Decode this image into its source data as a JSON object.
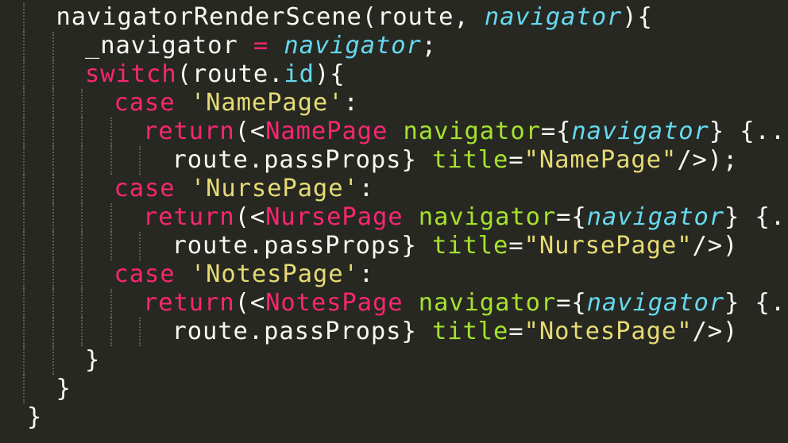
{
  "editor": {
    "theme": "monokai",
    "colors": {
      "background": "#272822",
      "plain": "#f8f8f2",
      "keyword": "#f92672",
      "string": "#e6db74",
      "parameter": "#66d9ef",
      "attribute": "#a6e22e",
      "indent_guide": "#5a5b53"
    },
    "lines": [
      {
        "indent": 1,
        "tokens": [
          {
            "t": "navigatorRenderScene(route, ",
            "c": "plain"
          },
          {
            "t": "navigator",
            "c": "parameter",
            "i": true
          },
          {
            "t": "){",
            "c": "plain"
          }
        ]
      },
      {
        "indent": 2,
        "tokens": [
          {
            "t": "_navigator ",
            "c": "plain"
          },
          {
            "t": "=",
            "c": "keyword"
          },
          {
            "t": " ",
            "c": "plain"
          },
          {
            "t": "navigator",
            "c": "parameter",
            "i": true
          },
          {
            "t": ";",
            "c": "plain"
          }
        ]
      },
      {
        "indent": 2,
        "tokens": [
          {
            "t": "switch",
            "c": "keyword"
          },
          {
            "t": "(route.",
            "c": "plain"
          },
          {
            "t": "id",
            "c": "parameter"
          },
          {
            "t": "){",
            "c": "plain"
          }
        ]
      },
      {
        "indent": 3,
        "tokens": [
          {
            "t": "case",
            "c": "keyword"
          },
          {
            "t": " ",
            "c": "plain"
          },
          {
            "t": "'NamePage'",
            "c": "string"
          },
          {
            "t": ":",
            "c": "plain"
          }
        ]
      },
      {
        "indent": 4,
        "tokens": [
          {
            "t": "return",
            "c": "keyword"
          },
          {
            "t": "(<",
            "c": "plain"
          },
          {
            "t": "NamePage",
            "c": "keyword"
          },
          {
            "t": " ",
            "c": "plain"
          },
          {
            "t": "navigator",
            "c": "attribute"
          },
          {
            "t": "=",
            "c": "plain"
          },
          {
            "t": "{",
            "c": "plain"
          },
          {
            "t": "navigator",
            "c": "parameter",
            "i": true
          },
          {
            "t": "} {...",
            "c": "plain"
          }
        ]
      },
      {
        "indent": 5,
        "tokens": [
          {
            "t": "route.passProps} ",
            "c": "plain"
          },
          {
            "t": "title",
            "c": "attribute"
          },
          {
            "t": "=",
            "c": "plain"
          },
          {
            "t": "\"NamePage\"",
            "c": "string"
          },
          {
            "t": "/>);",
            "c": "plain"
          }
        ]
      },
      {
        "indent": 3,
        "tokens": [
          {
            "t": "case",
            "c": "keyword"
          },
          {
            "t": " ",
            "c": "plain"
          },
          {
            "t": "'NursePage'",
            "c": "string"
          },
          {
            "t": ":",
            "c": "plain"
          }
        ]
      },
      {
        "indent": 4,
        "tokens": [
          {
            "t": "return",
            "c": "keyword"
          },
          {
            "t": "(<",
            "c": "plain"
          },
          {
            "t": "NursePage",
            "c": "keyword"
          },
          {
            "t": " ",
            "c": "plain"
          },
          {
            "t": "navigator",
            "c": "attribute"
          },
          {
            "t": "=",
            "c": "plain"
          },
          {
            "t": "{",
            "c": "plain"
          },
          {
            "t": "navigator",
            "c": "parameter",
            "i": true
          },
          {
            "t": "} {...",
            "c": "plain"
          }
        ]
      },
      {
        "indent": 5,
        "tokens": [
          {
            "t": "route.passProps} ",
            "c": "plain"
          },
          {
            "t": "title",
            "c": "attribute"
          },
          {
            "t": "=",
            "c": "plain"
          },
          {
            "t": "\"NursePage\"",
            "c": "string"
          },
          {
            "t": "/>)",
            "c": "plain"
          }
        ]
      },
      {
        "indent": 3,
        "tokens": [
          {
            "t": "case",
            "c": "keyword"
          },
          {
            "t": " ",
            "c": "plain"
          },
          {
            "t": "'NotesPage'",
            "c": "string"
          },
          {
            "t": ":",
            "c": "plain"
          }
        ]
      },
      {
        "indent": 4,
        "tokens": [
          {
            "t": "return",
            "c": "keyword"
          },
          {
            "t": "(<",
            "c": "plain"
          },
          {
            "t": "NotesPage",
            "c": "keyword"
          },
          {
            "t": " ",
            "c": "plain"
          },
          {
            "t": "navigator",
            "c": "attribute"
          },
          {
            "t": "=",
            "c": "plain"
          },
          {
            "t": "{",
            "c": "plain"
          },
          {
            "t": "navigator",
            "c": "parameter",
            "i": true
          },
          {
            "t": "} {...",
            "c": "plain"
          }
        ]
      },
      {
        "indent": 5,
        "tokens": [
          {
            "t": "route.passProps} ",
            "c": "plain"
          },
          {
            "t": "title",
            "c": "attribute"
          },
          {
            "t": "=",
            "c": "plain"
          },
          {
            "t": "\"NotesPage\"",
            "c": "string"
          },
          {
            "t": "/>)",
            "c": "plain"
          }
        ]
      },
      {
        "indent": 2,
        "tokens": [
          {
            "t": "}",
            "c": "plain"
          }
        ]
      },
      {
        "indent": 1,
        "tokens": [
          {
            "t": "}",
            "c": "plain"
          }
        ]
      },
      {
        "indent": 0,
        "tokens": [
          {
            "t": "}",
            "c": "plain"
          }
        ]
      }
    ]
  }
}
